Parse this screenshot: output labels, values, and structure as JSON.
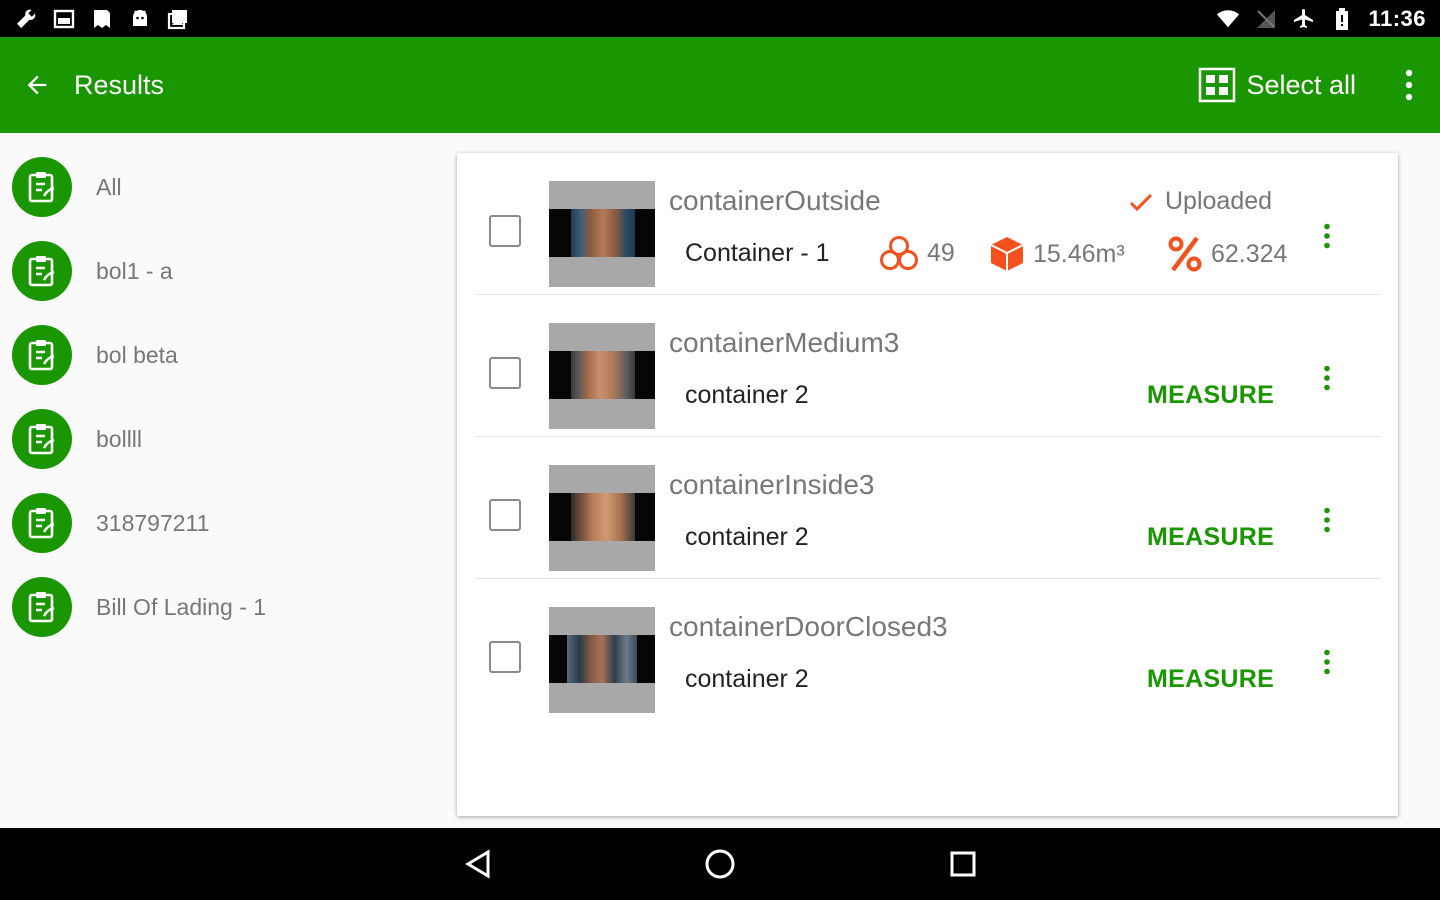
{
  "status_bar": {
    "time": "11:36",
    "left_icons": [
      "wrench-icon",
      "image-icon",
      "bookmark-icon",
      "android-icon",
      "photos-icon"
    ],
    "right_icons": [
      "wifi-icon",
      "signal-off-icon",
      "airplane-icon",
      "battery-icon"
    ]
  },
  "app_bar": {
    "title": "Results",
    "select_all_label": "Select all",
    "color": "#1a9600"
  },
  "sidebar": {
    "items": [
      {
        "label": "All"
      },
      {
        "label": "bol1 - a"
      },
      {
        "label": "bol beta"
      },
      {
        "label": "bollll"
      },
      {
        "label": "318797211"
      },
      {
        "label": "Bill Of Lading - 1"
      }
    ]
  },
  "results": [
    {
      "name": "containerOutside",
      "container": "Container - 1",
      "status": "Uploaded",
      "count": "49",
      "volume": "15.46m³",
      "percent": "62.324"
    },
    {
      "name": "containerMedium3",
      "container": "container 2",
      "action": "MEASURE"
    },
    {
      "name": "containerInside3",
      "container": "container 2",
      "action": "MEASURE"
    },
    {
      "name": "containerDoorClosed3",
      "container": "container 2",
      "action": "MEASURE"
    }
  ],
  "colors": {
    "accent": "#1a9600",
    "stat_orange": "#f4511e"
  },
  "nav_bar": {
    "buttons": [
      "back-triangle-icon",
      "home-circle-icon",
      "recents-square-icon"
    ]
  }
}
